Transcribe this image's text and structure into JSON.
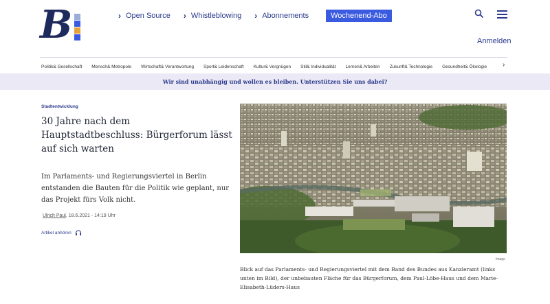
{
  "brand": {
    "logo_letter": "B",
    "colors": {
      "navy": "#1f2a5c",
      "bar_blue": "#3a5ae0",
      "bar_orange": "#e8a23a",
      "bar_light": "#9aaed8"
    }
  },
  "nav": {
    "items": [
      {
        "label": "Open Source"
      },
      {
        "label": "Whistleblowing"
      },
      {
        "label": "Abonnements"
      }
    ],
    "cta_label": "Wochenend-Abo",
    "login_label": "Anmelden"
  },
  "categories": [
    "Politik& Gesellschaft",
    "Mensch& Metropole",
    "Wirtschaft& Verantwortung",
    "Sport& Leidenschaft",
    "Kultur& Vergnügen",
    "Stil& Individualität",
    "Lernen& Arbeiten",
    "Zukunft& Technologie",
    "Gesundheit& Ökologie"
  ],
  "banner": {
    "text": "Wir sind unabhängig und wollen es bleiben. Unterstützen Sie uns dabei?"
  },
  "article": {
    "kicker": "Stadtentwicklung",
    "headline": "30 Jahre nach dem Hauptstadtbeschluss: Bürgerforum lässt auf sich warten",
    "teaser": "Im Parlaments- und Regierungsviertel in Berlin entstanden die Bauten für die Politik wie geplant, nur das Projekt fürs Volk nicht.",
    "author": "Ulrich Paul",
    "date": ", 18.6.2021 - 14:19 Uhr",
    "listen_label": "Artikel anhören"
  },
  "image": {
    "credit": "Imago",
    "caption": "Blick auf das Parlaments- und Regierungsviertel mit dem Band des Bundes aus Kanzleramt (links unten im Bild), der unbebauten Fläche für das Bürgerforum, dem Paul-Löbe-Haus und dem Marie-Elisabeth-Lüders-Haus"
  }
}
